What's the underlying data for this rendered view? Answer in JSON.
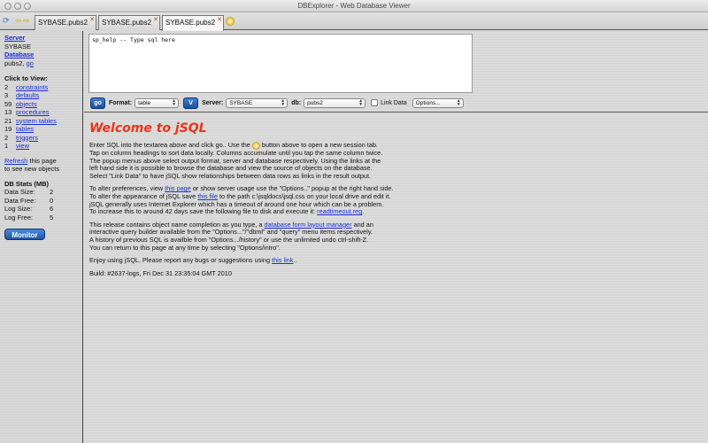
{
  "window": {
    "title": "DBExplorer - Web Database Viewer"
  },
  "toolbar": {
    "tabs": [
      "SYBASE.pubs2",
      "SYBASE.pubs2",
      "SYBASE.pubs2"
    ]
  },
  "sidebar": {
    "server_label": "Server",
    "server_value": "SYBASE",
    "database_label": "Database",
    "database_value": "pubs2,",
    "go_link": "go",
    "click_to_view": "Click to View:",
    "items": [
      {
        "count": "2",
        "label": "constraints"
      },
      {
        "count": "3",
        "label": "defaults"
      },
      {
        "count": "59",
        "label": "objects"
      },
      {
        "count": "13",
        "label": "procedures"
      },
      {
        "count": "21",
        "label": "system tables"
      },
      {
        "count": "19",
        "label": "tables"
      },
      {
        "count": "2",
        "label": "triggers"
      },
      {
        "count": "1",
        "label": "view"
      }
    ],
    "refresh_link": "Refresh",
    "refresh_text1": "this page",
    "refresh_text2": "to see new objects",
    "stats_title": "DB Stats (MB)",
    "stats": [
      {
        "label": "Data Size:",
        "value": "2"
      },
      {
        "label": "Data Free:",
        "value": "0"
      },
      {
        "label": "Log Size:",
        "value": "6"
      },
      {
        "label": "Log Free:",
        "value": "5"
      }
    ],
    "monitor_label": "Monitor"
  },
  "editor": {
    "sql_text": "sp_help -- Type sql here"
  },
  "controls": {
    "go_label": "go",
    "format_label": "Format:",
    "format_value": "table",
    "v_label": "V",
    "server_label": "Server:",
    "server_value": "SYBASE",
    "db_label": "db:",
    "db_value": "pubs2",
    "link_data_label": "Link Data",
    "options_value": "Options..."
  },
  "content": {
    "heading": "Welcome to jSQL",
    "p1_a": "Enter SQL into the textarea above and click go.. Use the",
    "p1_b": "button above to open a new session tab.",
    "p1_l2": "Tap on column headings to sort data locally. Columns accumulate until you tap the same column twice.",
    "p1_l3": "The popup menus above select output format, server and database respectively. Using the links at the",
    "p1_l4": "left hand side it is possible to browse the database and view the source of objects on the database.",
    "p1_l5": "Select \"Link Data\" to have jSQL show relationships between data rows as links in the result output.",
    "p2_a": "To alter preferences, view",
    "p2_link": "this page",
    "p2_b": "or show server usage use the \"Options..\" popup at the right hand side.",
    "p2_l2a": "To alter the appearance of jSQL save",
    "p2_l2link": "this file",
    "p2_l2b": "to the path c:\\jsqldocs\\jsql.css on your local drive and edit it.",
    "p2_l3": "jSQL generally uses Internet Explorer which has a timeout of around one hour which can be a problem.",
    "p2_l4a": "To increase this to around 42 days save the following file to disk and execute it:",
    "p2_l4link": "readtimeout.reg",
    "p2_l4b": ".",
    "p3_a": "This release contains object name completion as you type, a",
    "p3_link": "database form layout manager",
    "p3_b": "and an",
    "p3_l2": "interactive query builder available from the \"Options...\"/\"dbml\" and \"query\" menu items respectively.",
    "p3_l3": "A history of previous SQL is availble from \"Options.../history\" or use the unlimited undo ctrl-shift-Z.",
    "p3_l4": "You can return to this page at any time by selecting \"Options/intro\".",
    "p4_a": "Enjoy using jSQL. Please report any bugs or suggestions using",
    "p4_link": "this link",
    "p4_b": "..",
    "build": "Build: #2637-logs, Fri Dec 31 23:35:04 GMT 2010"
  }
}
